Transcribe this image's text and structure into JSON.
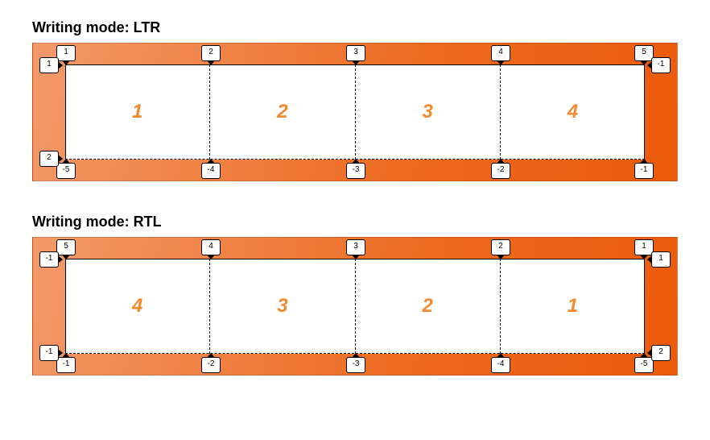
{
  "ltr": {
    "title": "Writing mode: LTR",
    "cells": [
      "1",
      "2",
      "3",
      "4"
    ],
    "row_labels_left": {
      "top": "1",
      "bottom": "2"
    },
    "row_labels_right": {
      "top": "-1",
      "bottom": ""
    },
    "col_labels_top": [
      "1",
      "2",
      "3",
      "4",
      "5"
    ],
    "col_labels_bottom": [
      "-5",
      "-4",
      "-3",
      "-2",
      "-1"
    ]
  },
  "rtl": {
    "title": "Writing mode: RTL",
    "cells": [
      "4",
      "3",
      "2",
      "1"
    ],
    "row_labels_left": {
      "top": "-1",
      "bottom": "-1"
    },
    "row_labels_right": {
      "top": "1",
      "bottom": "2"
    },
    "col_labels_top": [
      "5",
      "4",
      "3",
      "2",
      "1"
    ],
    "col_labels_bottom": [
      "-1",
      "-2",
      "-3",
      "-4",
      "-5"
    ]
  },
  "chart_data": {
    "type": "table",
    "description": "CSS Grid line numbering under LTR vs RTL writing modes, 4 columns × 1 row.",
    "diagrams": [
      {
        "writing_mode": "LTR",
        "columns": 4,
        "rows": 1,
        "column_line_numbers_start_to_end": [
          1,
          2,
          3,
          4,
          5
        ],
        "column_line_numbers_negative": [
          -5,
          -4,
          -3,
          -2,
          -1
        ],
        "row_line_numbers_start_to_end": [
          1,
          2
        ],
        "row_line_numbers_negative_shown": [
          -1
        ],
        "cell_order_left_to_right": [
          1,
          2,
          3,
          4
        ]
      },
      {
        "writing_mode": "RTL",
        "columns": 4,
        "rows": 1,
        "column_line_numbers_start_to_end": [
          5,
          4,
          3,
          2,
          1
        ],
        "column_line_numbers_negative": [
          -1,
          -2,
          -3,
          -4,
          -5
        ],
        "row_line_numbers_start_to_end": [
          1,
          2
        ],
        "row_line_numbers_negative_shown": [
          -1
        ],
        "cell_order_left_to_right": [
          4,
          3,
          2,
          1
        ]
      }
    ]
  }
}
